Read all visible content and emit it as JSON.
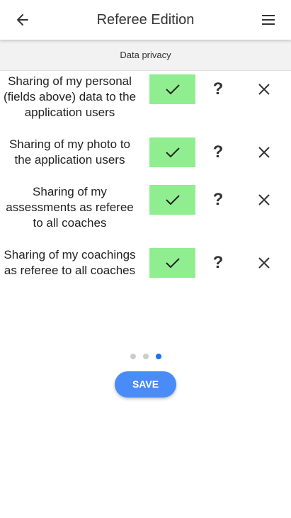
{
  "header": {
    "title": "Referee Edition",
    "back_icon": "arrow-left-icon",
    "menu_icon": "hamburger-menu-icon"
  },
  "section": {
    "title": "Data privacy"
  },
  "rows": [
    {
      "label": "Sharing of my personal (fields above) data to the application users",
      "state": "accepted"
    },
    {
      "label": "Sharing of my photo to the application users",
      "state": "accepted"
    },
    {
      "label": "Sharing of my assessments as referee to all coaches",
      "state": "accepted"
    },
    {
      "label": "Sharing of my coachings as referee to all coaches",
      "state": "accepted"
    }
  ],
  "actions": {
    "help_symbol": "?",
    "accept_icon": "check-icon",
    "decline_icon": "close-icon"
  },
  "pager": {
    "total": 3,
    "current": 3
  },
  "save_label": "SAVE",
  "colors": {
    "accept_bg": "#90ee90",
    "save_bg": "#4a8cf7",
    "active_dot": "#1a73e8",
    "inactive_dot": "#cccccc",
    "section_bg": "#f2f2f2"
  }
}
